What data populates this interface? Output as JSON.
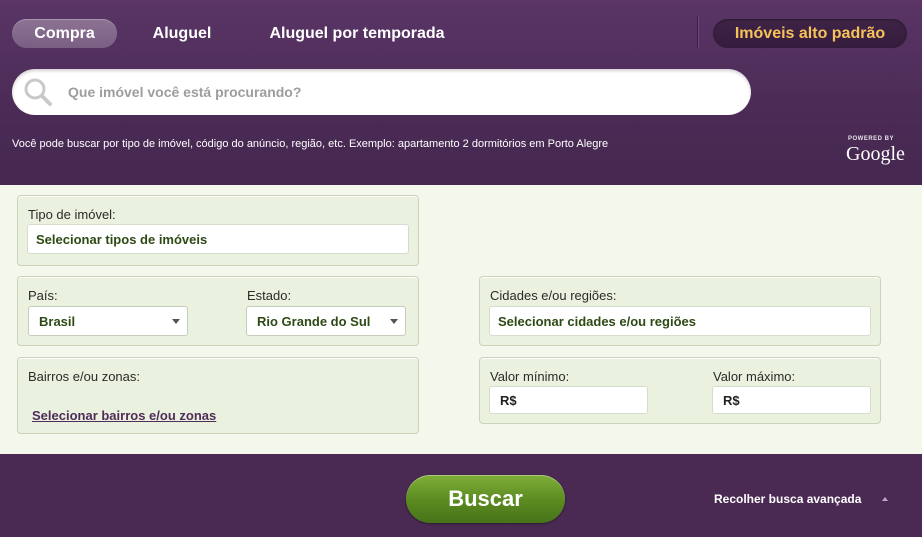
{
  "tabs": {
    "compra": "Compra",
    "aluguel": "Aluguel",
    "temporada": "Aluguel por temporada",
    "alto_padrao": "Imóveis alto padrão"
  },
  "search": {
    "placeholder": "Que imóvel você está procurando?",
    "hint": "Você pode buscar por tipo de imóvel, código do anúncio, região, etc. Exemplo: apartamento 2 dormitórios em Porto Alegre",
    "powered_by": "POWERED BY",
    "google": "Google"
  },
  "form": {
    "tipo_label": "Tipo de imóvel:",
    "tipo_value": "Selecionar tipos de imóveis",
    "pais_label": "País:",
    "pais_value": "Brasil",
    "estado_label": "Estado:",
    "estado_value": "Rio Grande do Sul",
    "cidades_label": "Cidades e/ou regiões:",
    "cidades_value": "Selecionar cidades e/ou regiões",
    "bairros_label": "Bairros e/ou zonas:",
    "bairros_link": "Selecionar bairros e/ou zonas",
    "valor_min_label": "Valor mínimo:",
    "valor_min_value": "R$",
    "valor_max_label": "Valor máximo:",
    "valor_max_value": "R$"
  },
  "footer": {
    "buscar": "Buscar",
    "recolher": "Recolher busca avançada"
  },
  "colors": {
    "header_bg": "#4c2c57",
    "accent_gold": "#f6c25a",
    "button_green": "#5a8a1f",
    "panel_bg": "#eaf1df"
  },
  "icons": [
    "search-icon",
    "chevron-down-icon",
    "arrow-up-icon"
  ]
}
